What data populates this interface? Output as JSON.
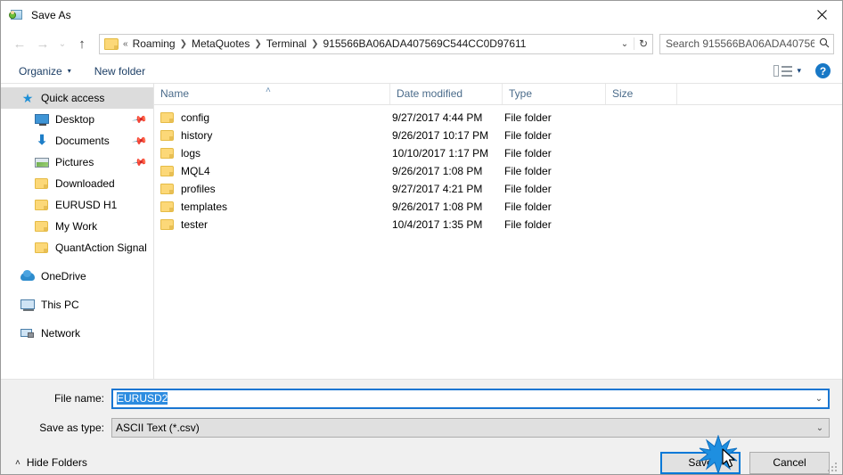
{
  "window": {
    "title": "Save As",
    "app_icon": "save-as-app-icon",
    "close_label": "✕"
  },
  "nav": {
    "back": "←",
    "forward": "→",
    "recent": "⌄",
    "up": "↑",
    "breadcrumb_prefix": "«",
    "breadcrumbs": [
      "Roaming",
      "MetaQuotes",
      "Terminal",
      "915566BA06ADA407569C544CC0D97611"
    ],
    "separator": "❯",
    "dropdown_caret": "⌄",
    "refresh": "↻"
  },
  "search": {
    "placeholder": "Search 915566BA06ADA40756...",
    "icon": "search-icon"
  },
  "toolbar": {
    "organize_label": "Organize",
    "organize_caret": "▾",
    "new_folder_label": "New folder",
    "view_caret": "▾",
    "help_label": "?"
  },
  "sidebar": {
    "items": [
      {
        "label": "Quick access",
        "icon": "star-icon",
        "level": 0,
        "selected": true,
        "pinned": false
      },
      {
        "label": "Desktop",
        "icon": "monitor-icon",
        "level": 1,
        "selected": false,
        "pinned": true
      },
      {
        "label": "Documents",
        "icon": "download-arrow-icon",
        "level": 1,
        "selected": false,
        "pinned": true
      },
      {
        "label": "Pictures",
        "icon": "picture-icon",
        "level": 1,
        "selected": false,
        "pinned": true
      },
      {
        "label": "Downloaded",
        "icon": "folder-icon",
        "level": 1,
        "selected": false,
        "pinned": false
      },
      {
        "label": "EURUSD H1",
        "icon": "folder-icon",
        "level": 1,
        "selected": false,
        "pinned": false
      },
      {
        "label": "My Work",
        "icon": "folder-icon",
        "level": 1,
        "selected": false,
        "pinned": false
      },
      {
        "label": "QuantAction Signal",
        "icon": "folder-icon",
        "level": 1,
        "selected": false,
        "pinned": false
      },
      {
        "label": "OneDrive",
        "icon": "cloud-icon",
        "level": 0,
        "selected": false,
        "pinned": false,
        "gap": true
      },
      {
        "label": "This PC",
        "icon": "computer-icon",
        "level": 0,
        "selected": false,
        "pinned": false,
        "gap": true
      },
      {
        "label": "Network",
        "icon": "network-icon",
        "level": 0,
        "selected": false,
        "pinned": false,
        "gap": true
      }
    ],
    "pin_glyph": "📌"
  },
  "filelist": {
    "columns": [
      "Name",
      "Date modified",
      "Type",
      "Size"
    ],
    "sort_caret": "˄",
    "rows": [
      {
        "name": "config",
        "date": "9/27/2017 4:44 PM",
        "type": "File folder",
        "size": ""
      },
      {
        "name": "history",
        "date": "9/26/2017 10:17 PM",
        "type": "File folder",
        "size": ""
      },
      {
        "name": "logs",
        "date": "10/10/2017 1:17 PM",
        "type": "File folder",
        "size": ""
      },
      {
        "name": "MQL4",
        "date": "9/26/2017 1:08 PM",
        "type": "File folder",
        "size": ""
      },
      {
        "name": "profiles",
        "date": "9/27/2017 4:21 PM",
        "type": "File folder",
        "size": ""
      },
      {
        "name": "templates",
        "date": "9/26/2017 1:08 PM",
        "type": "File folder",
        "size": ""
      },
      {
        "name": "tester",
        "date": "10/4/2017 1:35 PM",
        "type": "File folder",
        "size": ""
      }
    ]
  },
  "footer": {
    "file_name_label": "File name:",
    "file_name_value": "EURUSD2",
    "save_type_label": "Save as type:",
    "save_type_value": "ASCII Text (*.csv)",
    "combo_caret": "⌄",
    "hide_folders_label": "Hide Folders",
    "hide_folders_caret": "˄",
    "save_label": "Save",
    "cancel_label": "Cancel"
  },
  "colors": {
    "accent": "#0078d7",
    "selection": "#2d8ce0",
    "sidebar_selected": "#dcdcdc",
    "footer_bg": "#f0f0f0",
    "folder_yellow": "#fcd878"
  }
}
